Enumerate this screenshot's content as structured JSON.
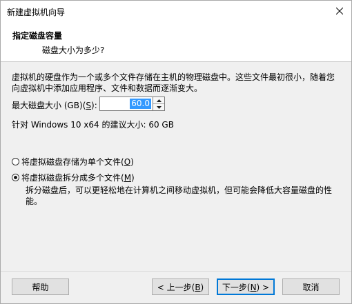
{
  "window": {
    "title": "新建虚拟机向导"
  },
  "icons": {
    "close": "close-icon",
    "spin_up": "chevron-up-icon",
    "spin_down": "chevron-down-icon"
  },
  "header": {
    "title": "指定磁盘容量",
    "subtitle": "磁盘大小为多少?"
  },
  "description": "虚拟机的硬盘作为一个或多个文件存储在主机的物理磁盘中。这些文件最初很小，随着您向虚拟机中添加应用程序、文件和数据而逐渐变大。",
  "disk_size": {
    "label_prefix": "最大磁盘大小 (GB)(",
    "label_key": "S",
    "label_suffix": "):",
    "value": "60.0"
  },
  "recommendation": "针对 Windows 10 x64 的建议大小: 60 GB",
  "options": [
    {
      "prefix": "将虚拟磁盘存储为单个文件(",
      "key": "O",
      "suffix": ")",
      "checked": false
    },
    {
      "prefix": "将虚拟磁盘拆分成多个文件(",
      "key": "M",
      "suffix": ")",
      "checked": true
    }
  ],
  "split_description": "拆分磁盘后，可以更轻松地在计算机之间移动虚拟机，但可能会降低大容量磁盘的性能。",
  "buttons": {
    "help": "帮助",
    "back_prefix": "< 上一步(",
    "back_key": "B",
    "back_suffix": ")",
    "next_prefix": "下一步(",
    "next_key": "N",
    "next_suffix": ") >",
    "cancel": "取消"
  }
}
